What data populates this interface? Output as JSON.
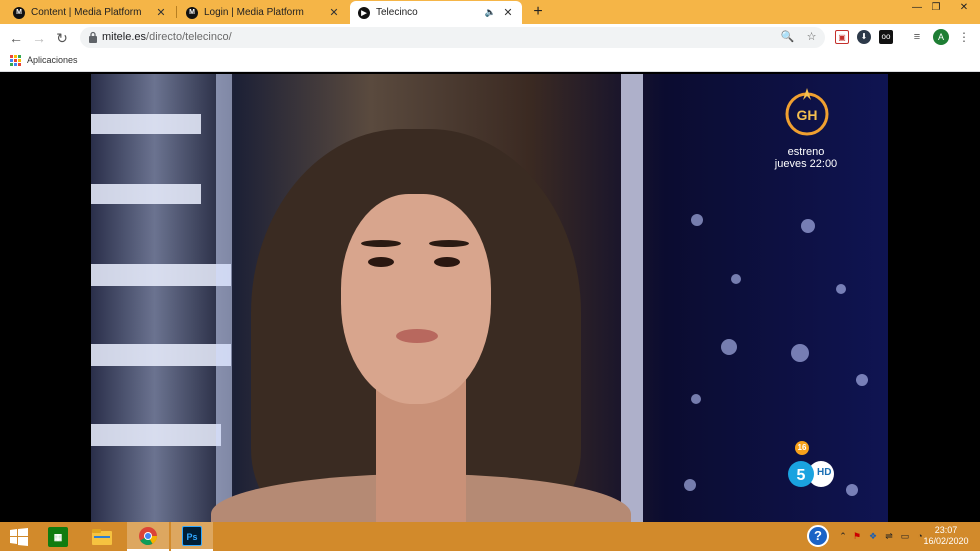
{
  "browser": {
    "tabs": [
      {
        "favicon": "M",
        "title": "Content | Media Platform",
        "active": false
      },
      {
        "favicon": "M",
        "title": "Login | Media Platform",
        "active": false
      },
      {
        "favicon": "▶",
        "title": "Telecinco",
        "active": true
      }
    ],
    "new_tab_icon": "+",
    "window_controls": {
      "minimize": "—",
      "maximize": "❐",
      "close": "✕"
    },
    "address": {
      "domain": "mitele.es",
      "path": "/directo/telecinco/"
    },
    "bookmarks": {
      "apps_label": "Aplicaciones"
    },
    "profile_initial": "A",
    "colors": {
      "tabstrip": "#f5b547",
      "taskbar": "#d28a2b"
    }
  },
  "video": {
    "promo_text_line1": "estreno",
    "promo_text_line2": "jueves 22:00",
    "age_rating": "16",
    "channel_hd": "HD"
  },
  "taskbar": {
    "items": [
      {
        "name": "windows-start-icon"
      },
      {
        "name": "calculator-icon",
        "glyph": "▦"
      },
      {
        "name": "file-explorer-icon"
      },
      {
        "name": "chrome-icon",
        "active": true
      },
      {
        "name": "photoshop-icon",
        "glyph": "Ps"
      }
    ],
    "help_glyph": "?",
    "clock": {
      "time": "23:07",
      "date": "16/02/2020"
    }
  }
}
